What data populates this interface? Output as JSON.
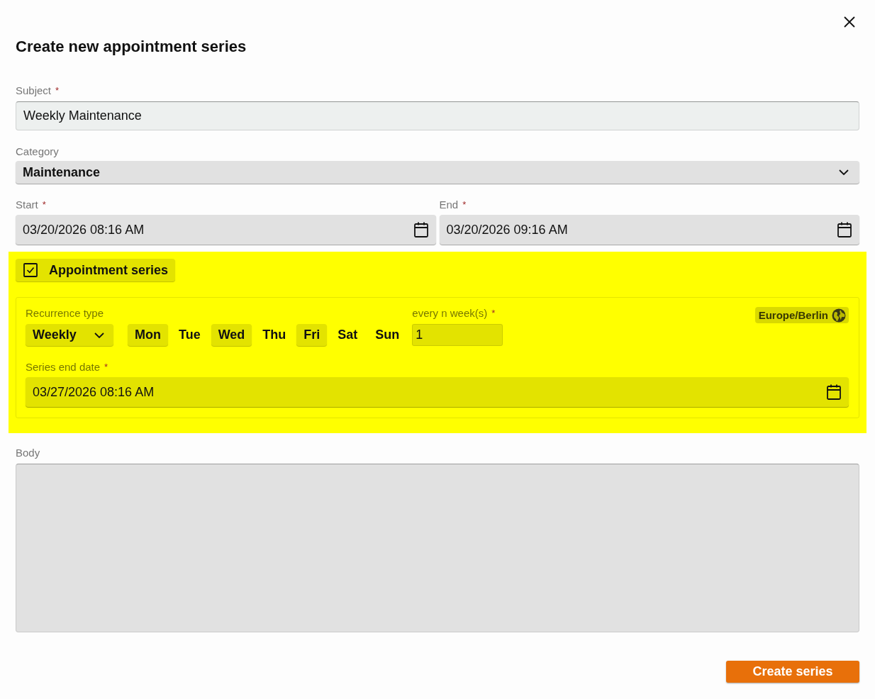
{
  "dialog": {
    "title": "Create new appointment series"
  },
  "subject": {
    "label": "Subject",
    "required_mark": "*",
    "value": "Weekly Maintenance"
  },
  "category": {
    "label": "Category",
    "value": "Maintenance"
  },
  "start": {
    "label": "Start",
    "required_mark": "*",
    "value": "03/20/2026 08:16 AM"
  },
  "end": {
    "label": "End",
    "required_mark": "*",
    "value": "03/20/2026 09:16 AM"
  },
  "appointment_series": {
    "highlighted": true,
    "label": "Appointment series",
    "checked": true,
    "recurrence_type": {
      "label": "Recurrence type",
      "value": "Weekly"
    },
    "days": [
      {
        "label": "Mon",
        "selected": true
      },
      {
        "label": "Tue",
        "selected": false
      },
      {
        "label": "Wed",
        "selected": true
      },
      {
        "label": "Thu",
        "selected": false
      },
      {
        "label": "Fri",
        "selected": true
      },
      {
        "label": "Sat",
        "selected": false
      },
      {
        "label": "Sun",
        "selected": false
      }
    ],
    "interval": {
      "label": "every n week(s)",
      "required_mark": "*",
      "value": "1"
    },
    "timezone": "Europe/Berlin",
    "series_end_date": {
      "label": "Series end date",
      "required_mark": "*",
      "value": "03/27/2026 08:16 AM"
    }
  },
  "body": {
    "label": "Body"
  },
  "buttons": [
    {
      "label": "Create series",
      "kind": "primary"
    }
  ]
}
